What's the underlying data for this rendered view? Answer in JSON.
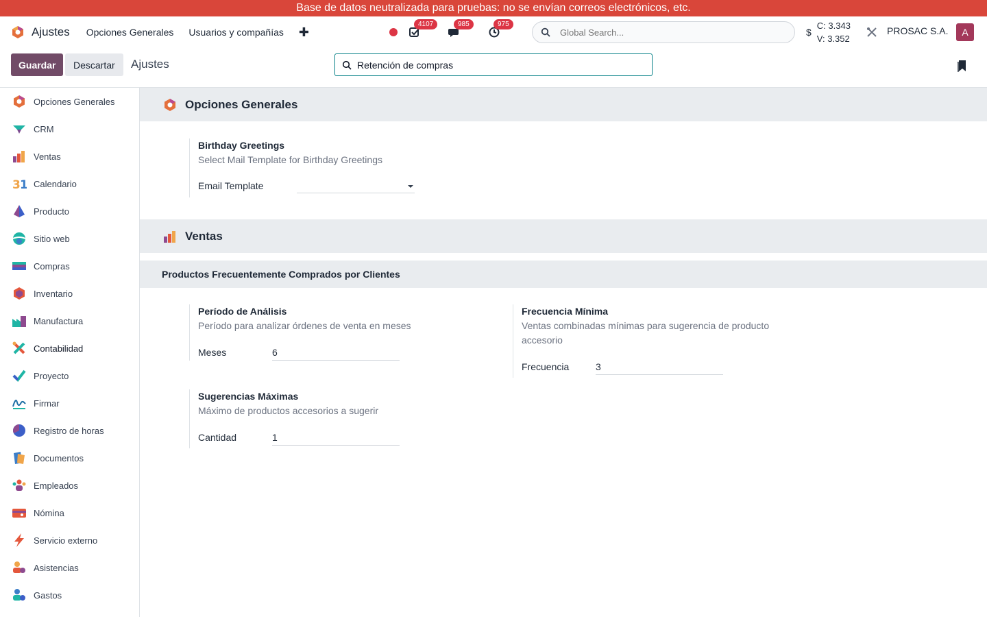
{
  "banner": "Base de datos neutralizada para pruebas: no se envían correos electrónicos, etc.",
  "navbar": {
    "app_name": "Ajustes",
    "menus": [
      "Opciones Generales",
      "Usuarios y compañías"
    ],
    "add_icon": "plus-icon",
    "activity_count": "4107",
    "messages_count": "985",
    "clock_count": "975",
    "search_placeholder": "Global Search...",
    "currency_symbol": "$",
    "rate_c": "C: 3.343",
    "rate_v": "V: 3.352",
    "company": "PROSAC S.A.",
    "avatar_letter": "A",
    "colors": {
      "banner": "#d9463a",
      "avatar": "#a3385a",
      "badge": "#dc3545"
    }
  },
  "control": {
    "save_label": "Guardar",
    "discard_label": "Descartar",
    "breadcrumb": "Ajustes",
    "search_value": "Retención de compras",
    "colors": {
      "save": "#714b67",
      "search_border": "#017e84"
    }
  },
  "sidebar": {
    "items": [
      {
        "label": "Opciones Generales",
        "icon": "settings-app-icon"
      },
      {
        "label": "CRM",
        "icon": "crm-icon"
      },
      {
        "label": "Ventas",
        "icon": "sales-icon"
      },
      {
        "label": "Calendario",
        "icon": "calendar-icon"
      },
      {
        "label": "Producto",
        "icon": "product-icon"
      },
      {
        "label": "Sitio web",
        "icon": "website-icon"
      },
      {
        "label": "Compras",
        "icon": "purchase-icon"
      },
      {
        "label": "Inventario",
        "icon": "inventory-icon"
      },
      {
        "label": "Manufactura",
        "icon": "manufacturing-icon"
      },
      {
        "label": "Contabilidad",
        "icon": "accounting-icon"
      },
      {
        "label": "Proyecto",
        "icon": "project-icon"
      },
      {
        "label": "Firmar",
        "icon": "sign-icon"
      },
      {
        "label": "Registro de horas",
        "icon": "timesheet-icon"
      },
      {
        "label": "Documentos",
        "icon": "documents-icon"
      },
      {
        "label": "Empleados",
        "icon": "employees-icon"
      },
      {
        "label": "Nómina",
        "icon": "payroll-icon"
      },
      {
        "label": "Servicio externo",
        "icon": "field-service-icon"
      },
      {
        "label": "Asistencias",
        "icon": "attendance-icon"
      },
      {
        "label": "Gastos",
        "icon": "expenses-icon"
      }
    ]
  },
  "content": {
    "general": {
      "title": "Opciones Generales",
      "birthday": {
        "title": "Birthday Greetings",
        "desc": "Select Mail Template for Birthday Greetings",
        "field_label": "Email Template",
        "field_value": ""
      }
    },
    "sales": {
      "title": "Ventas",
      "subsection": "Productos Frecuentemente Comprados por Clientes",
      "period": {
        "title": "Período de Análisis",
        "desc": "Período para analizar órdenes de venta en meses",
        "field_label": "Meses",
        "field_value": "6"
      },
      "frequency": {
        "title": "Frecuencia Mínima",
        "desc": "Ventas combinadas mínimas para sugerencia de producto accesorio",
        "field_label": "Frecuencia",
        "field_value": "3"
      },
      "max_suggestions": {
        "title": "Sugerencias Máximas",
        "desc": "Máximo de productos accesorios a sugerir",
        "field_label": "Cantidad",
        "field_value": "1"
      }
    }
  }
}
